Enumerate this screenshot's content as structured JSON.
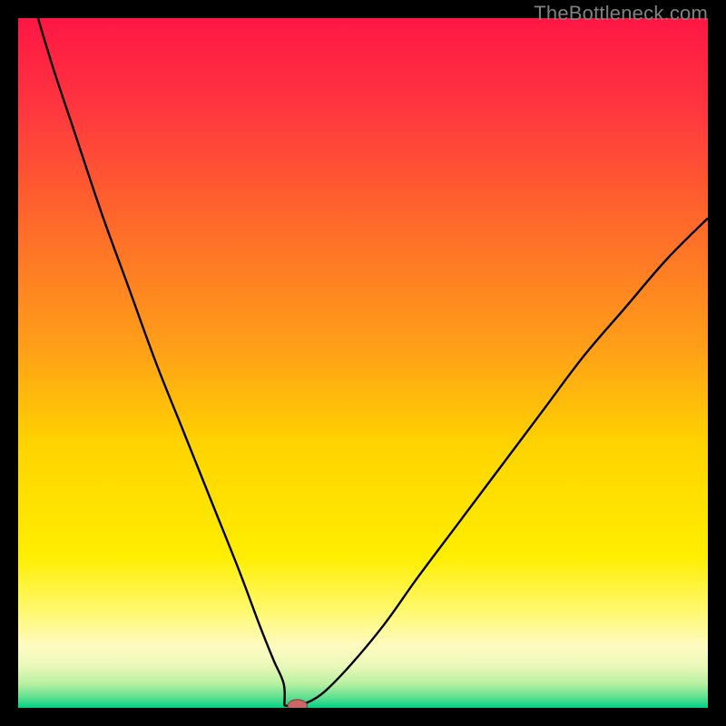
{
  "watermark": "TheBottleneck.com",
  "colors": {
    "black": "#000000",
    "curve": "#000000",
    "marker_fill": "#cc6666",
    "marker_stroke": "#8a3a3a"
  },
  "chart_data": {
    "type": "line",
    "title": "",
    "xlabel": "",
    "ylabel": "",
    "xlim": [
      0,
      100
    ],
    "ylim": [
      0,
      100
    ],
    "grid": false,
    "legend": false,
    "gradient_stops": [
      {
        "offset": 0.0,
        "color": "#ff1744"
      },
      {
        "offset": 0.12,
        "color": "#ff3340"
      },
      {
        "offset": 0.3,
        "color": "#ff6a2a"
      },
      {
        "offset": 0.48,
        "color": "#ffa018"
      },
      {
        "offset": 0.62,
        "color": "#ffd400"
      },
      {
        "offset": 0.78,
        "color": "#ffee00"
      },
      {
        "offset": 0.86,
        "color": "#fff970"
      },
      {
        "offset": 0.91,
        "color": "#fffbc0"
      },
      {
        "offset": 0.94,
        "color": "#e8f8b8"
      },
      {
        "offset": 0.965,
        "color": "#b8f0a0"
      },
      {
        "offset": 0.985,
        "color": "#5ee090"
      },
      {
        "offset": 1.0,
        "color": "#00d084"
      }
    ],
    "series": [
      {
        "name": "bottleneck-curve",
        "x": [
          0,
          2,
          5,
          8,
          12,
          16,
          20,
          24,
          28,
          32,
          35,
          37,
          38.5,
          39.2,
          39.8,
          40,
          41,
          44,
          48,
          53,
          58,
          64,
          70,
          76,
          82,
          88,
          94,
          100
        ],
        "y": [
          110,
          103,
          93,
          84,
          72,
          61,
          50,
          40,
          30,
          20,
          12,
          7,
          3.5,
          1.5,
          0.6,
          0.3,
          0.4,
          2,
          6,
          12,
          19,
          27,
          35,
          43,
          51,
          58,
          65,
          71
        ]
      }
    ],
    "marker": {
      "x": 40.5,
      "y": 0.3,
      "rx": 1.4,
      "ry": 0.9
    },
    "flat_segment": {
      "x_start": 38.6,
      "x_end": 40.0,
      "y": 0.3
    }
  }
}
